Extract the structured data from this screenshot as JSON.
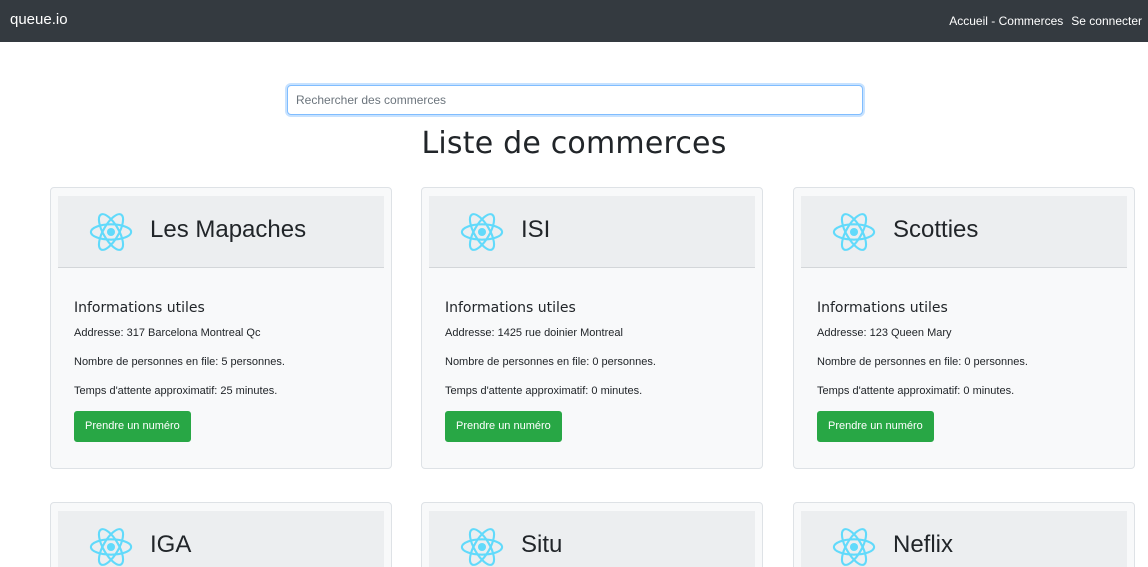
{
  "navbar": {
    "brand": "queue.io",
    "links": [
      "Accueil - Commerces",
      "Se connecter"
    ]
  },
  "search": {
    "placeholder": "Rechercher des commerces"
  },
  "page_title": "Liste de commerces",
  "colors": {
    "navbar": "#343a40",
    "button": "#28a745",
    "logo": "#61dafb",
    "search_focus": "#80bdff"
  },
  "icons": {
    "card_logo": "react-logo-icon"
  },
  "cards": [
    {
      "name": "Les Mapaches",
      "info_title": "Informations utiles",
      "address": "Addresse: 317 Barcelona Montreal Qc",
      "queue": "Nombre de personnes en file: 5 personnes.",
      "wait": "Temps d'attente approximatif: 25 minutes.",
      "button": "Prendre un numéro"
    },
    {
      "name": "ISI",
      "info_title": "Informations utiles",
      "address": "Addresse: 1425 rue doinier Montreal",
      "queue": "Nombre de personnes en file: 0 personnes.",
      "wait": "Temps d'attente approximatif: 0 minutes.",
      "button": "Prendre un numéro"
    },
    {
      "name": "Scotties",
      "info_title": "Informations utiles",
      "address": "Addresse: 123 Queen Mary",
      "queue": "Nombre de personnes en file: 0 personnes.",
      "wait": "Temps d'attente approximatif: 0 minutes.",
      "button": "Prendre un numéro"
    },
    {
      "name": "IGA"
    },
    {
      "name": "Situ"
    },
    {
      "name": "Neflix"
    }
  ]
}
